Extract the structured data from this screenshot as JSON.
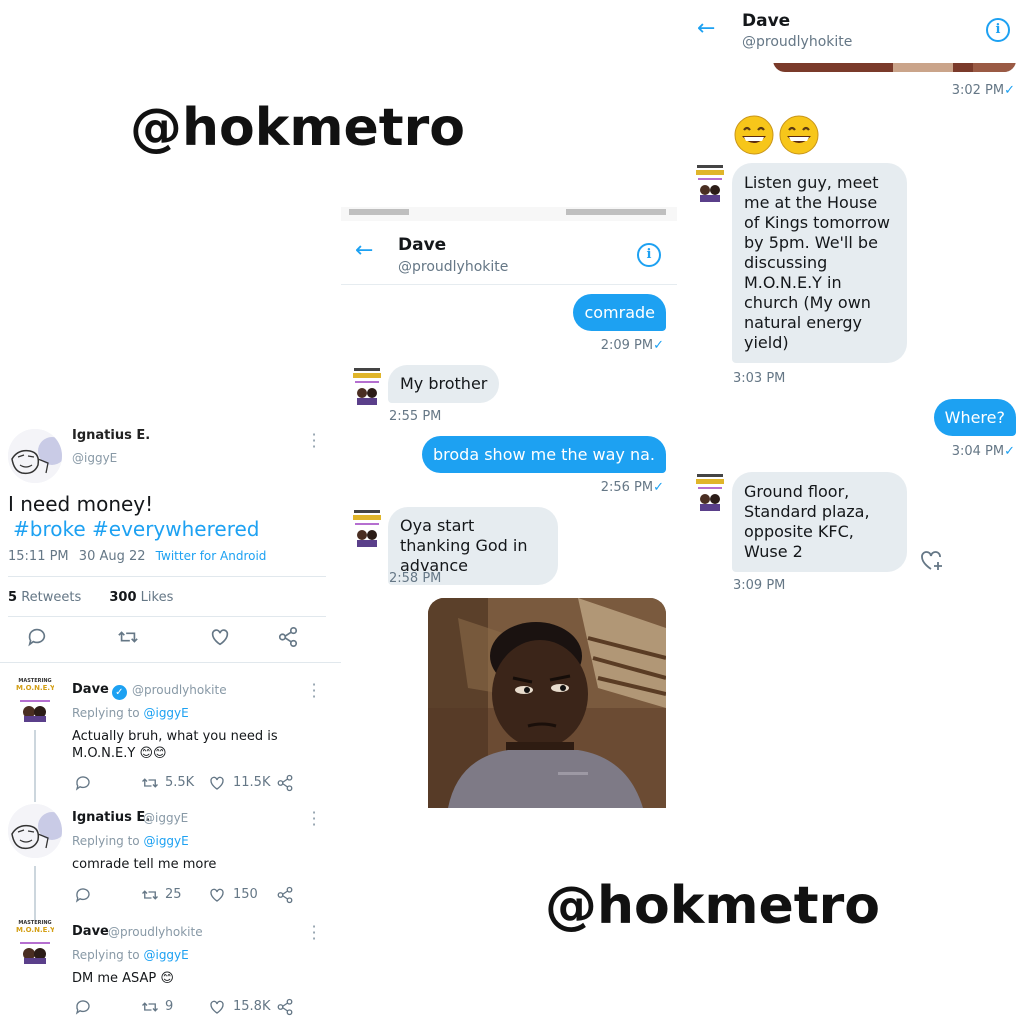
{
  "watermarks": [
    "@hokmetro",
    "@hokmetro"
  ],
  "tweet": {
    "author_name": "Ignatius E.",
    "author_handle": "@iggyE",
    "text": "I need money!",
    "hashtags": "#broke #everywherered",
    "time": "15:11 PM",
    "date": "30 Aug 22",
    "source": "Twitter for Android",
    "retweets_count": "5",
    "retweets_label": "Retweets",
    "likes_count": "300",
    "likes_label": "Likes",
    "icons": [
      "reply-icon",
      "retweet-icon",
      "like-icon",
      "share-icon"
    ],
    "replies": [
      {
        "name": "Dave",
        "handle": "@proudlyhokite",
        "verified": true,
        "replying_prefix": "Replying to",
        "replying_to": "@iggyE",
        "text": "Actually bruh, what you need is M.O.N.E.Y 😊😊",
        "retweets": "5.5K",
        "likes": "11.5K"
      },
      {
        "name": "Ignatius E.",
        "handle": "@iggyE",
        "verified": false,
        "replying_prefix": "Replying to",
        "replying_to": "@iggyE",
        "text": "comrade tell me more",
        "retweets": "25",
        "likes": "150"
      },
      {
        "name": "Dave",
        "handle": "@proudlyhokite",
        "verified": false,
        "replying_prefix": "Replying to",
        "replying_to": "@iggyE",
        "text": "DM me ASAP 😊",
        "retweets": "9",
        "likes": "15.8K"
      }
    ]
  },
  "dm_middle": {
    "header": {
      "name": "Dave",
      "handle": "@proudlyhokite"
    },
    "messages": [
      {
        "direction": "out",
        "text": "comrade",
        "time": "2:09 PM",
        "read": "✓"
      },
      {
        "direction": "in",
        "text": "My brother",
        "time": "2:55 PM"
      },
      {
        "direction": "out",
        "text": "broda show me the way na.",
        "time": "2:56 PM",
        "read": "✓"
      },
      {
        "direction": "in",
        "text": "Oya start thanking God in advance",
        "time": "2:58 PM"
      }
    ]
  },
  "dm_right": {
    "header": {
      "name": "Dave",
      "handle": "@proudlyhokite"
    },
    "top_time": "3:02 PM",
    "top_read": "✓",
    "emojis": "😄😄",
    "messages": [
      {
        "direction": "in",
        "text": "Listen guy, meet me at the House of Kings tomorrow by 5pm. We'll be discussing M.O.N.E.Y in church (My own natural energy yield)",
        "time": "3:03 PM"
      },
      {
        "direction": "out",
        "text": "Where?",
        "time": "3:04 PM",
        "read": "✓"
      },
      {
        "direction": "in",
        "text": "Ground floor, Standard plaza, opposite KFC, Wuse 2",
        "time": "3:09 PM"
      }
    ]
  },
  "avatar_text": {
    "mastering": "MASTERING",
    "money": "M.O.N.E.Y"
  },
  "colors": {
    "twitter_blue": "#1da1f2",
    "bubble_in": "#e6ecf0",
    "gray_text": "#657786"
  }
}
